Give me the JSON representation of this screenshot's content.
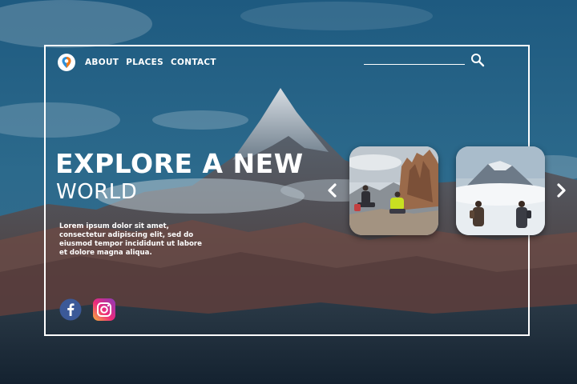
{
  "nav": {
    "links": [
      "ABOUT",
      "PLACES",
      "CONTACT"
    ],
    "logo_icon": "location-pin-icon"
  },
  "search": {
    "placeholder": "",
    "icon": "search-icon"
  },
  "hero": {
    "title": "EXPLORE A NEW",
    "subtitle": "WORLD",
    "text": "Lorem ipsum dolor sit amet, consectetur adipiscing elit, sed do eiusmod tempor incididunt ut labore et dolore magna aliqua."
  },
  "social": [
    "facebook-icon",
    "instagram-icon"
  ],
  "carousel": {
    "cards": [
      "hikers-on-rocky-summit-photo",
      "couple-before-volcano-photo"
    ],
    "prev_icon": "chevron-left-icon",
    "next_icon": "chevron-right-icon"
  },
  "colors": {
    "accent_orange": "#f07a1a",
    "accent_blue": "#2f8fd8",
    "facebook": "#3b5998",
    "sky": "#2a5f80"
  }
}
